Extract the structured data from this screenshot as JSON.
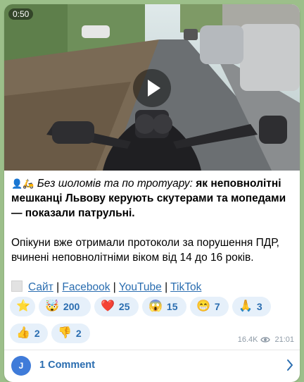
{
  "video": {
    "duration": "0:50"
  },
  "post": {
    "lead_emojis": "👤🛵",
    "italic_text": "Без шоломів та по тротуару:",
    "bold_text": "як неповнолітні мешканці Львову керують скутерами та мопедами — показали патрульні.",
    "body_text": "Опікуни вже отримали протоколи за порушення ПДР, вчинені неповнолітніми віком від 14 до 16 років."
  },
  "links": {
    "site": "Сайт",
    "facebook": "Facebook",
    "youtube": "YouTube",
    "tiktok": "TikTok",
    "separator": "|"
  },
  "reactions": [
    {
      "icon": "⭐",
      "name": "star",
      "count": ""
    },
    {
      "icon": "🤯",
      "name": "mind-blown",
      "count": "200"
    },
    {
      "icon": "❤️",
      "name": "heart",
      "count": "25"
    },
    {
      "icon": "😱",
      "name": "scream",
      "count": "15"
    },
    {
      "icon": "😁",
      "name": "grin",
      "count": "7"
    },
    {
      "icon": "🙏",
      "name": "pray",
      "count": "3"
    },
    {
      "icon": "👍",
      "name": "thumbs-up",
      "count": "2"
    },
    {
      "icon": "👎",
      "name": "thumbs-down",
      "count": "2"
    }
  ],
  "meta": {
    "views": "16.4K",
    "time": "21:01"
  },
  "comments": {
    "avatar_letter": "J",
    "label": "1 Comment"
  },
  "colors": {
    "accent": "#2a6db0",
    "reaction_bg": "#e6f0fa",
    "avatar": "#3f7bd9"
  }
}
